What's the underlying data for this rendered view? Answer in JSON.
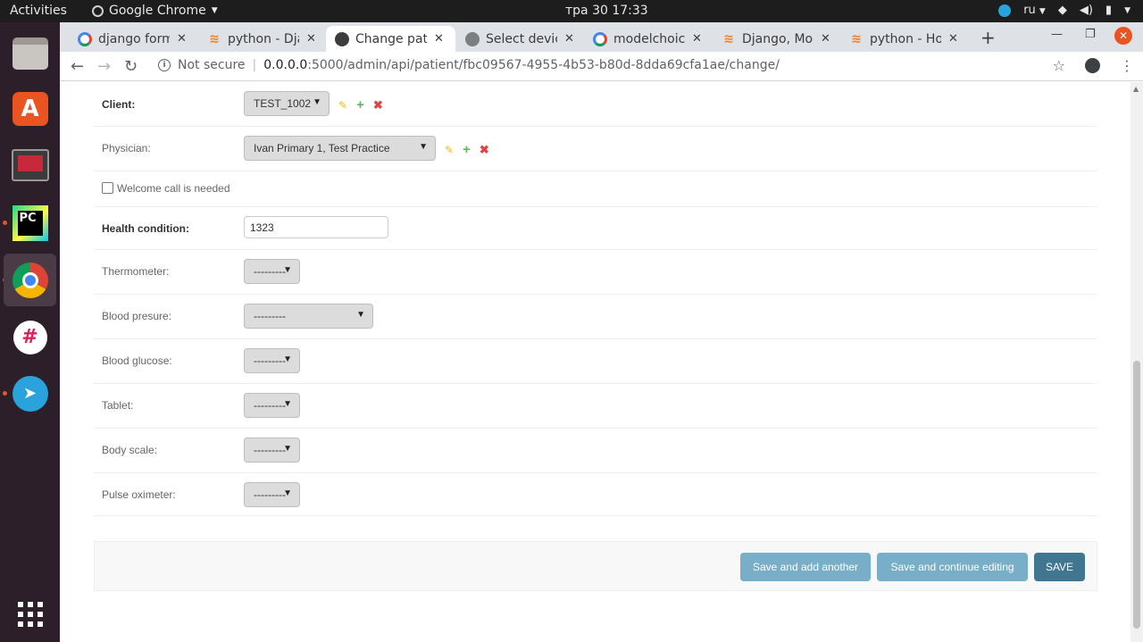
{
  "topbar": {
    "activities": "Activities",
    "app_name": "Google Chrome",
    "clock": "тра 30  17:33",
    "lang": "ru"
  },
  "browser": {
    "tabs": [
      {
        "title": "django forms",
        "icon": "google-icon"
      },
      {
        "title": "python - Djan",
        "icon": "stackoverflow-icon"
      },
      {
        "title": "Change patie",
        "icon": "globe-icon",
        "active": true
      },
      {
        "title": "Select device",
        "icon": "page-icon"
      },
      {
        "title": "modelchoice",
        "icon": "google-icon"
      },
      {
        "title": "Django, Mod",
        "icon": "stackoverflow-icon"
      },
      {
        "title": "python - How",
        "icon": "stackoverflow-icon"
      }
    ],
    "address": {
      "security": "Not secure",
      "host": "0.0.0.0",
      "path": ":5000/admin/api/patient/fbc09567-4955-4b53-b80d-8dda69cfa1ae/change/"
    }
  },
  "form": {
    "client": {
      "label": "Client:",
      "value": "TEST_1002"
    },
    "physician": {
      "label": "Physician:",
      "value": "Ivan Primary 1, Test Practice"
    },
    "welcome_call": {
      "label": "Welcome call is needed",
      "checked": false
    },
    "health_condition": {
      "label": "Health condition:",
      "value": "1323"
    },
    "thermometer": {
      "label": "Thermometer:",
      "value": "---------"
    },
    "blood_pressure": {
      "label": "Blood presure:",
      "value": "---------"
    },
    "blood_glucose": {
      "label": "Blood glucose:",
      "value": "---------"
    },
    "tablet": {
      "label": "Tablet:",
      "value": "---------"
    },
    "body_scale": {
      "label": "Body scale:",
      "value": "---------"
    },
    "pulse_oximeter": {
      "label": "Pulse oximeter:",
      "value": "---------"
    }
  },
  "buttons": {
    "save_add_another": "Save and add another",
    "save_continue": "Save and continue editing",
    "save": "SAVE"
  },
  "colors": {
    "button": "#79aec8",
    "save_button": "#417690",
    "dock": "#2c1f29",
    "tab_strip": "#dee1e6"
  }
}
